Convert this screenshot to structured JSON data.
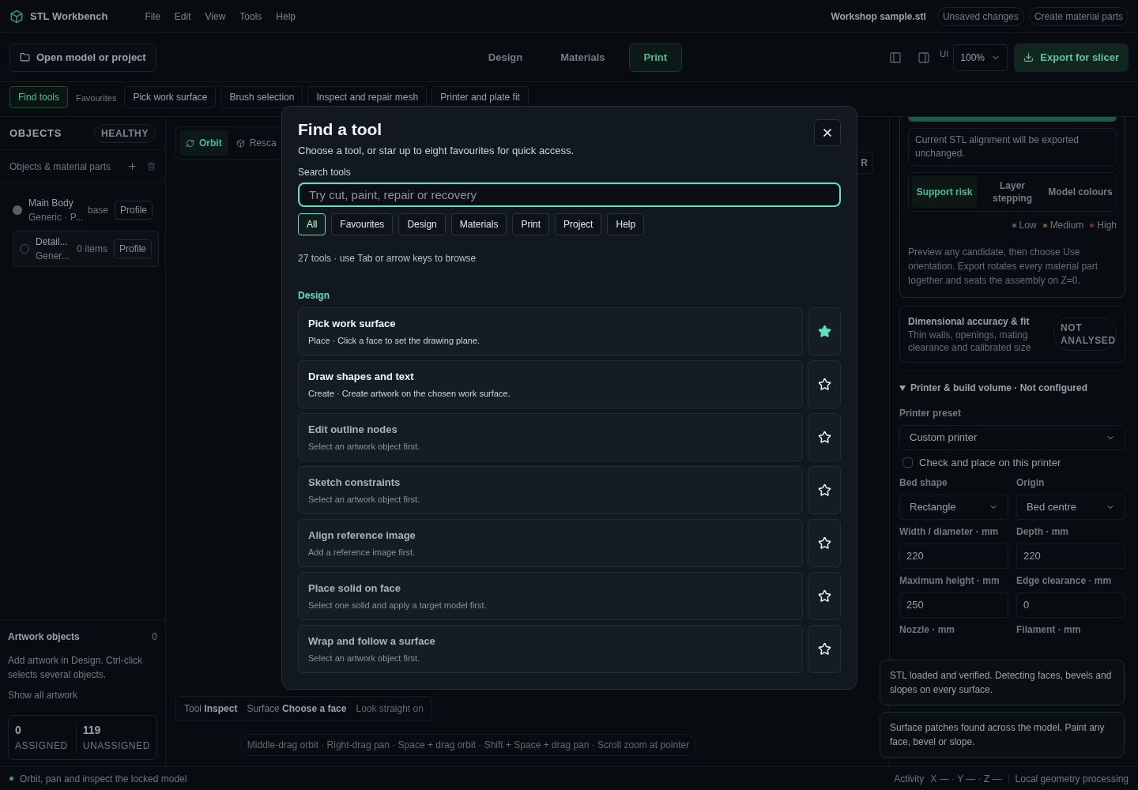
{
  "app": {
    "name": "STL Workbench",
    "menu": [
      "File",
      "Edit",
      "View",
      "Tools",
      "Help"
    ],
    "file_name": "Workshop sample.stl",
    "chips": [
      "Unsaved changes",
      "Create material parts"
    ]
  },
  "toolbar": {
    "open_button": "Open model or project",
    "modes": [
      {
        "label": "Design",
        "selected": false
      },
      {
        "label": "Materials",
        "selected": false
      },
      {
        "label": "Print",
        "selected": true
      }
    ],
    "ui_label": "UI",
    "zoom": "100%",
    "export_button": "Export for slicer"
  },
  "tool_strip": {
    "find": {
      "label": "Find tools",
      "selected": true
    },
    "favourites_label": "Favourites",
    "tools": [
      "Pick work surface",
      "Brush selection",
      "Inspect and repair mesh",
      "Printer and plate fit"
    ]
  },
  "sidebar": {
    "title": "OBJECTS",
    "status": "HEALTHY",
    "list_label": "Objects & material parts",
    "objects": [
      {
        "name": "Main Body",
        "detail": "Generic · P...",
        "tag": "base",
        "button": "Profile",
        "kind": "filled",
        "children": [
          {
            "name": "Detail...",
            "detail": "Gener...",
            "tag": "0 items",
            "button": "Profile",
            "kind": "ring"
          }
        ]
      }
    ],
    "artwork": {
      "title": "Artwork objects",
      "count": "0",
      "text": "Add artwork in Design. Ctrl-click selects several objects.",
      "link": "Show all artwork"
    },
    "stats": [
      {
        "value": "0",
        "label": "ASSIGNED"
      },
      {
        "value": "119",
        "label": "UNASSIGNED"
      }
    ]
  },
  "viewport": {
    "modes": [
      {
        "label": "Orbit",
        "selected": true
      },
      {
        "label": "Resca",
        "selected": false
      }
    ],
    "side_chip": "R",
    "info": [
      {
        "key": "Tool",
        "value": "Inspect"
      },
      {
        "key": "Surface",
        "value": "Choose a face"
      }
    ],
    "info_action": "Look straight on",
    "hints": "Middle-drag orbit · Right-drag pan · Space + drag orbit · Shift + Space + drag pan · Scroll zoom at pointer"
  },
  "right_panel": {
    "note": "Current STL alignment will be exported unchanged.",
    "tabs": [
      {
        "label": "Support risk",
        "selected": true
      },
      {
        "label": "Layer stepping",
        "selected": false
      },
      {
        "label": "Model colours",
        "selected": false
      }
    ],
    "legend": [
      {
        "label": "Low",
        "color": "#1f6f5a"
      },
      {
        "label": "Medium",
        "color": "#7a5a1e"
      },
      {
        "label": "High",
        "color": "#7a2a2e"
      }
    ],
    "help": "Preview any candidate, then choose Use orientation. Export rotates every material part together and seats the assembly on Z=0.",
    "accuracy": {
      "title": "Dimensional accuracy & fit",
      "text": "Thin walls, openings, mating clearance and calibrated size",
      "badge": "NOT ANALYSED"
    },
    "printer": {
      "heading": "Printer & build volume · Not configured",
      "expanded": true,
      "preset_label": "Printer preset",
      "preset": "Custom printer",
      "check_label": "Check and place on this printer",
      "checked": false,
      "fields": [
        {
          "label": "Bed shape",
          "value": "Rectangle",
          "kind": "select"
        },
        {
          "label": "Origin",
          "value": "Bed centre",
          "kind": "select"
        },
        {
          "label": "Width / diameter · mm",
          "value": "220",
          "kind": "input"
        },
        {
          "label": "Depth · mm",
          "value": "220",
          "kind": "input"
        },
        {
          "label": "Maximum height · mm",
          "value": "250",
          "kind": "input"
        },
        {
          "label": "Edge clearance · mm",
          "value": "0",
          "kind": "input"
        },
        {
          "label": "Nozzle · mm",
          "kind": "label"
        },
        {
          "label": "Filament · mm",
          "kind": "label"
        }
      ]
    }
  },
  "toasts": [
    "STL loaded and verified. Detecting faces, bevels and slopes on every surface.",
    "Surface patches found across the model. Paint any face, bevel or slope."
  ],
  "status_bar": {
    "left": "Orbit, pan and inspect the locked model",
    "activity": "Activity",
    "coords": "X — · Y — · Z —",
    "right": "Local geometry processing"
  },
  "dialog": {
    "title": "Find a tool",
    "subtitle": "Choose a tool, or star up to eight favourites for quick access.",
    "search_label": "Search tools",
    "placeholder": "Try cut, paint, repair or recovery",
    "filters": [
      {
        "label": "All",
        "selected": true
      },
      {
        "label": "Favourites",
        "selected": false
      },
      {
        "label": "Design",
        "selected": false
      },
      {
        "label": "Materials",
        "selected": false
      },
      {
        "label": "Print",
        "selected": false
      },
      {
        "label": "Project",
        "selected": false
      },
      {
        "label": "Help",
        "selected": false
      }
    ],
    "count": "27 tools · use Tab or arrow keys to browse",
    "section": "Design",
    "tools": [
      {
        "title": "Pick work surface",
        "text": "Place · Click a face to set the drawing plane.",
        "disabled": false,
        "favourite": true
      },
      {
        "title": "Draw shapes and text",
        "text": "Create · Create artwork on the chosen work surface.",
        "disabled": false,
        "favourite": false
      },
      {
        "title": "Edit outline nodes",
        "text": "Select an artwork object first.",
        "disabled": true,
        "favourite": false
      },
      {
        "title": "Sketch constraints",
        "text": "Select an artwork object first.",
        "disabled": true,
        "favourite": false
      },
      {
        "title": "Align reference image",
        "text": "Add a reference image first.",
        "disabled": true,
        "favourite": false
      },
      {
        "title": "Place solid on face",
        "text": "Select one solid and apply a target model first.",
        "disabled": true,
        "favourite": false
      },
      {
        "title": "Wrap and follow a surface",
        "text": "Select an artwork object first.",
        "disabled": true,
        "favourite": false
      }
    ]
  }
}
